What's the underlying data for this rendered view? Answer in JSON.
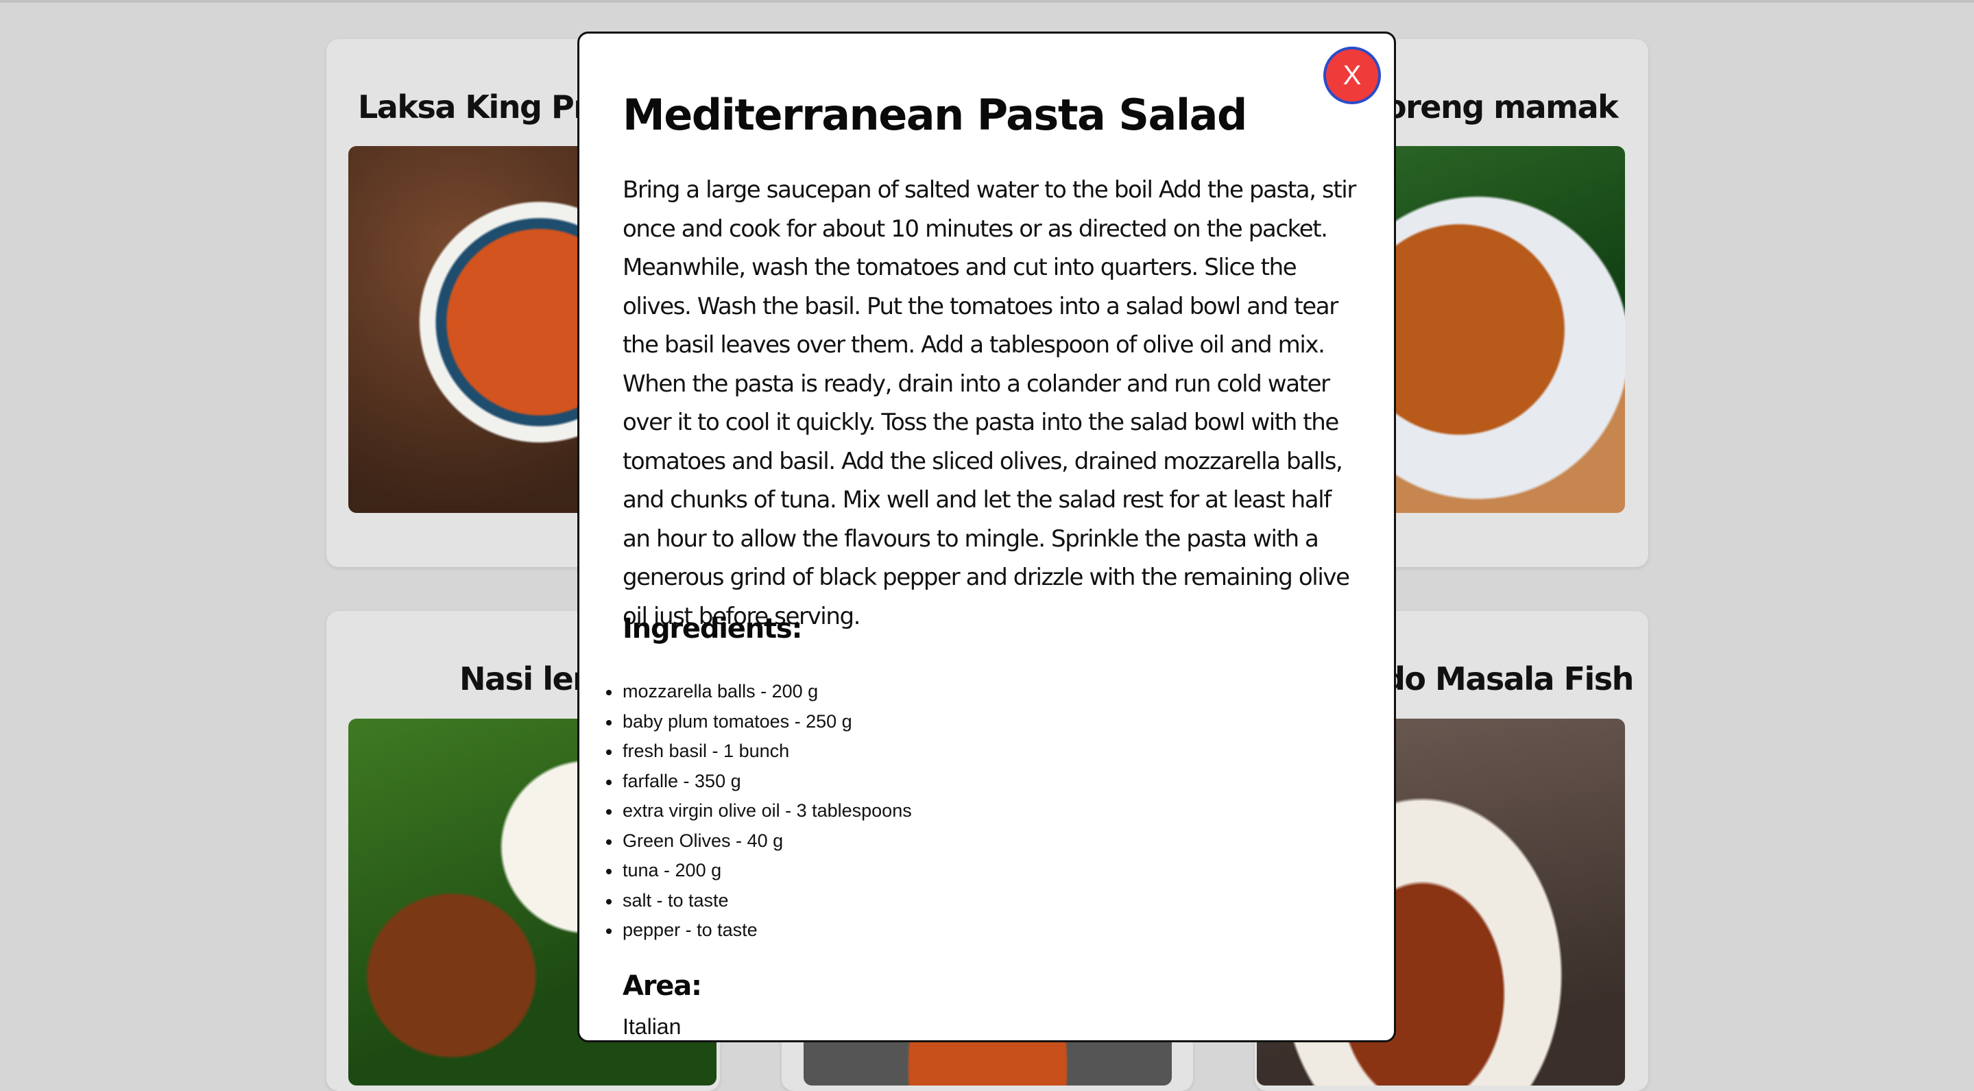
{
  "background_cards": [
    {
      "title": "Laksa King Prawn Noodles",
      "image": "laksa-photo"
    },
    {
      "title": "Mee goreng mamak",
      "image": "mee-goreng-photo"
    },
    {
      "title": "Nasi lemak",
      "image": "nasi-lemak-photo"
    },
    {
      "title": "",
      "image": "curry-photo"
    },
    {
      "title": "Kapitan Chicken / Do Masala Fish",
      "image": "masala-fish-photo"
    }
  ],
  "visible_titles": {
    "card1": "Laksa King Praw",
    "card2": "oreng mamak",
    "card3": "Nasi lema",
    "card5": "do Masala Fish"
  },
  "modal": {
    "close_label": "X",
    "title": "Mediterranean Pasta Salad",
    "instructions": "Bring a large saucepan of salted water to the boil Add the pasta, stir once and cook for about 10 minutes or as directed on the packet. Meanwhile, wash the tomatoes and cut into quarters. Slice the olives. Wash the basil. Put the tomatoes into a salad bowl and tear the basil leaves over them. Add a tablespoon of olive oil and mix. When the pasta is ready, drain into a colander and run cold water over it to cool it quickly. Toss the pasta into the salad bowl with the tomatoes and basil. Add the sliced olives, drained mozzarella balls, and chunks of tuna. Mix well and let the salad rest for at least half an hour to allow the flavours to mingle. Sprinkle the pasta with a generous grind of black pepper and drizzle with the remaining olive oil just before serving.",
    "ingredients_heading": "Ingredients:",
    "ingredients": [
      "mozzarella balls - 200 g",
      "baby plum tomatoes - 250 g",
      "fresh basil - 1 bunch",
      "farfalle - 350 g",
      "extra virgin olive oil - 3 tablespoons",
      "Green Olives - 40 g",
      "tuna - 200 g",
      "salt - to taste",
      "pepper - to taste"
    ],
    "area_heading": "Area:",
    "area_value": "Italian"
  },
  "colors": {
    "page_background": "#d6d6d6",
    "card_background": "#e3e3e3",
    "close_button": "#f03b3b",
    "close_button_border": "#2a4cc9"
  }
}
